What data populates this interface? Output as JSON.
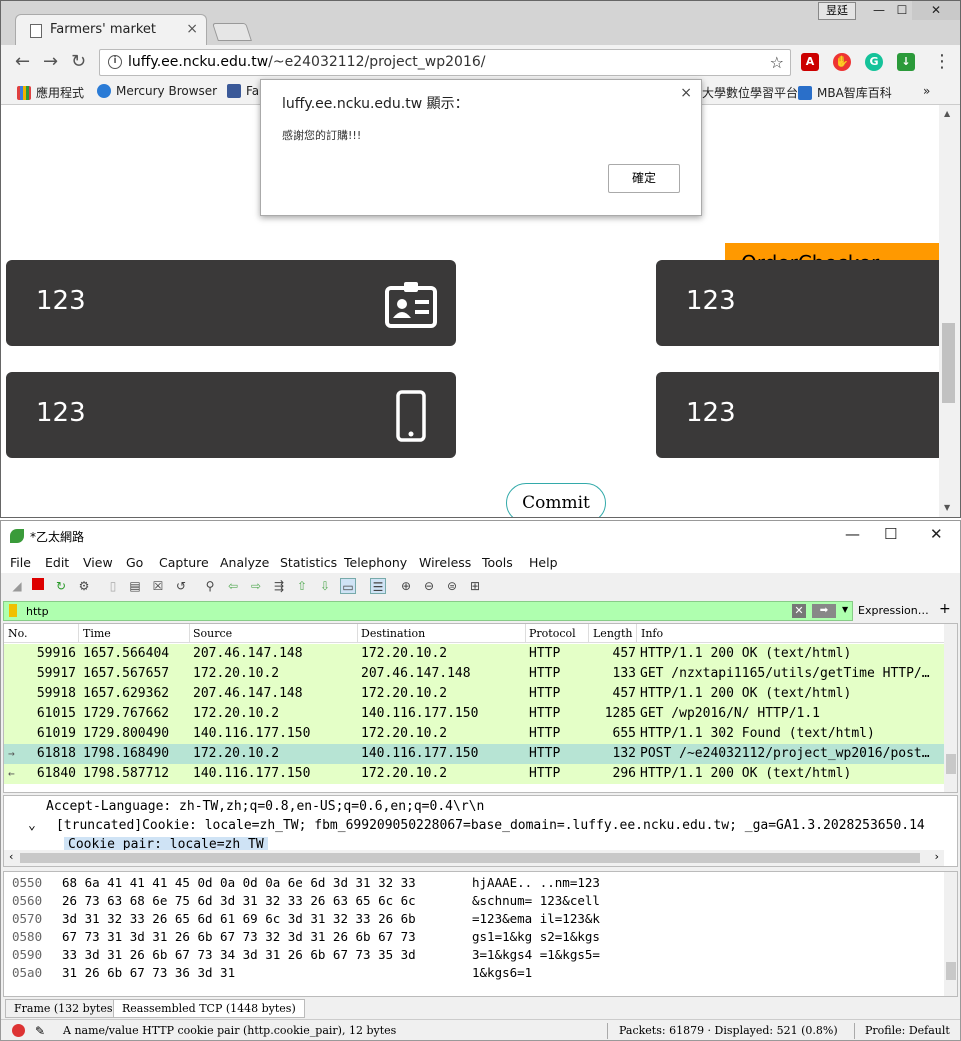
{
  "chrome": {
    "tab_title": "Farmers' market",
    "tab_close": "×",
    "user_button": "昱廷",
    "url_host": "luffy.ee.ncku.edu.tw",
    "url_path": "/~e24032112/project_wp2016/",
    "bookmarks": [
      {
        "label": "應用程式",
        "color": "#e04040"
      },
      {
        "label": "Mercury Browser",
        "color": "#2a7bd6"
      },
      {
        "label": "Fa",
        "color": "#3b5998"
      },
      {
        "label": "大學數位學習平台",
        "color": "#f2f2f2"
      },
      {
        "label": "MBA智库百科",
        "color": "#2a6fc9"
      }
    ],
    "bookmark_more": "»",
    "alert": {
      "title": "luffy.ee.ncku.edu.tw 顯示：",
      "message": "感謝您的訂購!!!",
      "ok": "確定",
      "close": "×"
    },
    "cards": [
      "123",
      "123",
      "123",
      "123"
    ],
    "order_checker_label": "OrderChecker",
    "commit_label": "Commit"
  },
  "wireshark": {
    "title": "*乙太網路",
    "menu": [
      "File",
      "Edit",
      "View",
      "Go",
      "Capture",
      "Analyze",
      "Statistics",
      "Telephony",
      "Wireless",
      "Tools",
      "Help"
    ],
    "filter_text": "http",
    "expression_label": "Expression…",
    "columns": [
      "No.",
      "Time",
      "Source",
      "Destination",
      "Protocol",
      "Length",
      "Info"
    ],
    "packets": [
      {
        "no": "59916",
        "time": "1657.566404",
        "src": "207.46.147.148",
        "dst": "172.20.10.2",
        "proto": "HTTP",
        "len": "457",
        "info": "HTTP/1.1 200 OK  (text/html)",
        "bg": "#e4ffc7"
      },
      {
        "no": "59917",
        "time": "1657.567657",
        "src": "172.20.10.2",
        "dst": "207.46.147.148",
        "proto": "HTTP",
        "len": "133",
        "info": "GET /nzxtapi1165/utils/getTime HTTP/…",
        "bg": "#e4ffc7"
      },
      {
        "no": "59918",
        "time": "1657.629362",
        "src": "207.46.147.148",
        "dst": "172.20.10.2",
        "proto": "HTTP",
        "len": "457",
        "info": "HTTP/1.1 200 OK  (text/html)",
        "bg": "#e4ffc7"
      },
      {
        "no": "61015",
        "time": "1729.767662",
        "src": "172.20.10.2",
        "dst": "140.116.177.150",
        "proto": "HTTP",
        "len": "1285",
        "info": "GET /wp2016/N/ HTTP/1.1",
        "bg": "#e4ffc7"
      },
      {
        "no": "61019",
        "time": "1729.800490",
        "src": "140.116.177.150",
        "dst": "172.20.10.2",
        "proto": "HTTP",
        "len": "655",
        "info": "HTTP/1.1 302 Found  (text/html)",
        "bg": "#e4ffc7"
      },
      {
        "no": "61818",
        "time": "1798.168490",
        "src": "172.20.10.2",
        "dst": "140.116.177.150",
        "proto": "HTTP",
        "len": "132",
        "info": "POST /~e24032112/project_wp2016/post…",
        "bg": "#b7e4d4",
        "mark": "→"
      },
      {
        "no": "61840",
        "time": "1798.587712",
        "src": "140.116.177.150",
        "dst": "172.20.10.2",
        "proto": "HTTP",
        "len": "296",
        "info": "HTTP/1.1 200 OK  (text/html)",
        "bg": "#e4ffc7",
        "mark": "←"
      }
    ],
    "detail_lines": [
      "Accept-Language: zh-TW,zh;q=0.8,en-US;q=0.6,en;q=0.4\\r\\n",
      "[truncated]Cookie: locale=zh_TW; fbm_699209050228067=base_domain=.luffy.ee.ncku.edu.tw; _ga=GA1.3.2028253650.14",
      "Cookie pair: locale=zh_TW"
    ],
    "hex_rows": [
      {
        "off": "0550",
        "bytes": "68 6a 41 41 41 45 0d 0a  0d 0a 6e 6d 3d 31 32 33",
        "ascii": "hjAAAE.. ..nm=123"
      },
      {
        "off": "0560",
        "bytes": "26 73 63 68 6e 75 6d 3d  31 32 33 26 63 65 6c 6c",
        "ascii": "&schnum= 123&cell"
      },
      {
        "off": "0570",
        "bytes": "3d 31 32 33 26 65 6d 61  69 6c 3d 31 32 33 26 6b",
        "ascii": "=123&ema il=123&k"
      },
      {
        "off": "0580",
        "bytes": "67 73 31 3d 31 26 6b 67  73 32 3d 31 26 6b 67 73",
        "ascii": "gs1=1&kg s2=1&kgs"
      },
      {
        "off": "0590",
        "bytes": "33 3d 31 26 6b 67 73 34  3d 31 26 6b 67 73 35 3d",
        "ascii": "3=1&kgs4 =1&kgs5="
      },
      {
        "off": "05a0",
        "bytes": "31 26 6b 67 73 36 3d 31",
        "ascii": "1&kgs6=1"
      }
    ],
    "byte_tabs": [
      "Frame (132 bytes)",
      "Reassembled TCP (1448 bytes)"
    ],
    "status": {
      "field": "A name/value HTTP cookie pair (http.cookie_pair), 12 bytes",
      "packets": "Packets: 61879 · Displayed: 521 (0.8%)",
      "profile": "Profile: Default"
    }
  }
}
